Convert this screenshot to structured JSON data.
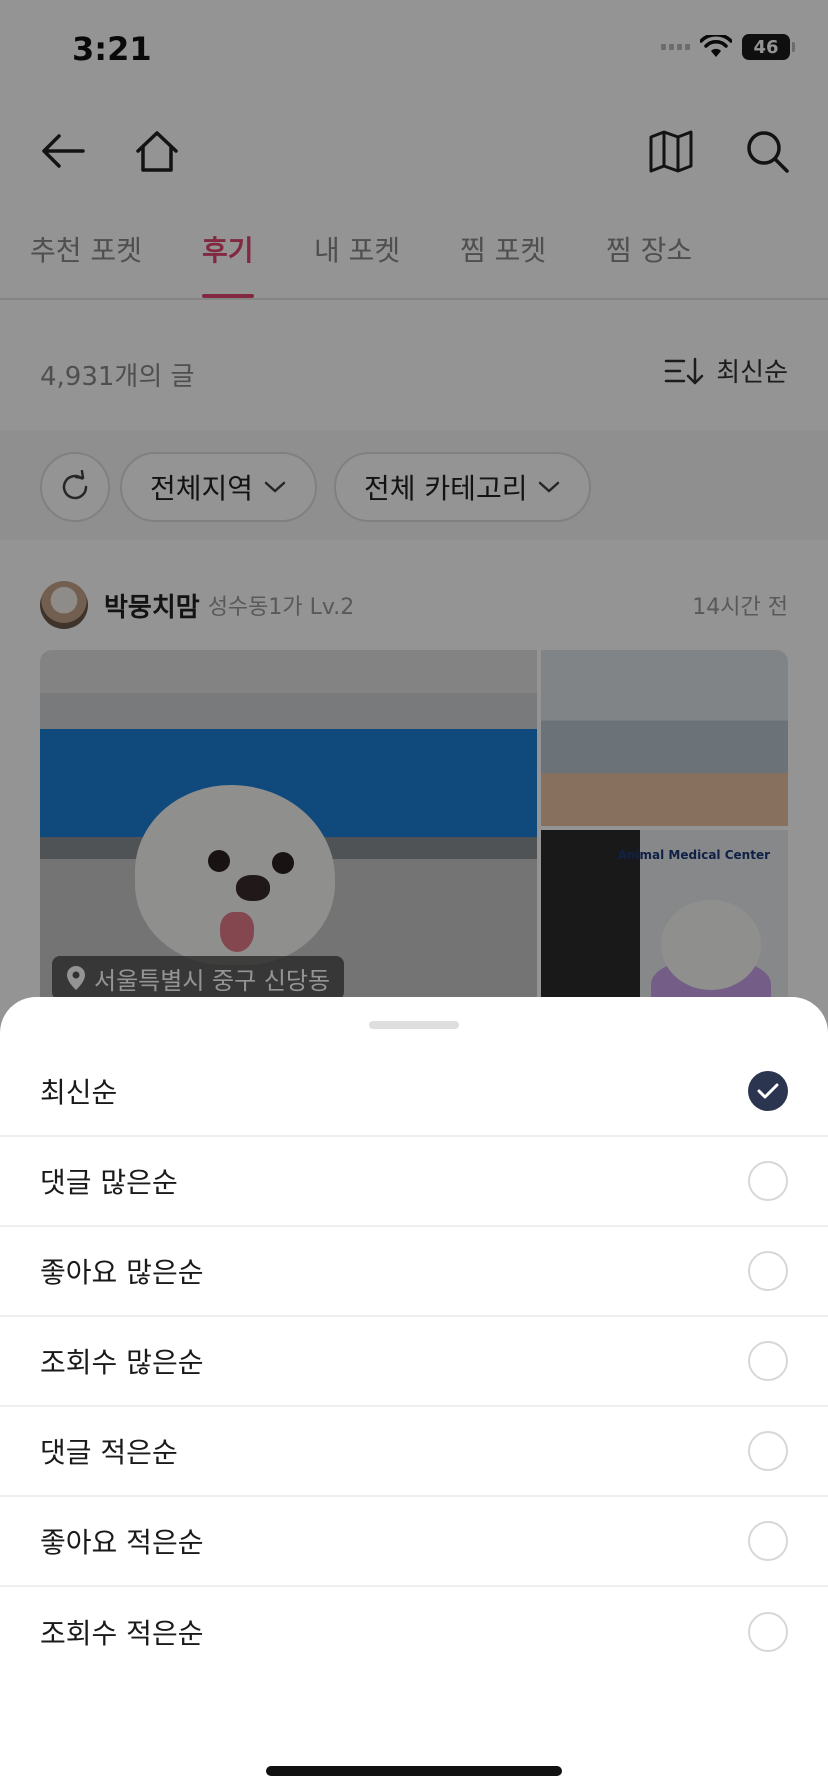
{
  "status_bar": {
    "time": "3:21",
    "battery": "46"
  },
  "nav": {
    "icons": [
      "back-arrow-icon",
      "home-icon",
      "map-icon",
      "search-icon"
    ],
    "tabs": [
      {
        "label": "추천 포켓",
        "active": false
      },
      {
        "label": "후기",
        "active": true
      },
      {
        "label": "내 포켓",
        "active": false
      },
      {
        "label": "찜 포켓",
        "active": false
      },
      {
        "label": "찜 장소",
        "active": false
      }
    ]
  },
  "list": {
    "post_count": "4,931개의 글",
    "sort_label": "최신순"
  },
  "filters": {
    "region": "전체지역",
    "category": "전체 카테고리"
  },
  "post": {
    "author": "박뭉치맘",
    "meta": "성수동1가 Lv.2",
    "time": "14시간 전",
    "location": "서울특별시 중구 신당동",
    "clinic_text": "Animal Medical Center"
  },
  "sort_sheet": {
    "options": [
      {
        "label": "최신순",
        "selected": true
      },
      {
        "label": "댓글 많은순",
        "selected": false
      },
      {
        "label": "좋아요 많은순",
        "selected": false
      },
      {
        "label": "조회수 많은순",
        "selected": false
      },
      {
        "label": "댓글 적은순",
        "selected": false
      },
      {
        "label": "좋아요 적은순",
        "selected": false
      },
      {
        "label": "조회수 적은순",
        "selected": false
      }
    ]
  },
  "colors": {
    "accent": "#e04770",
    "check": "#2c3550"
  }
}
